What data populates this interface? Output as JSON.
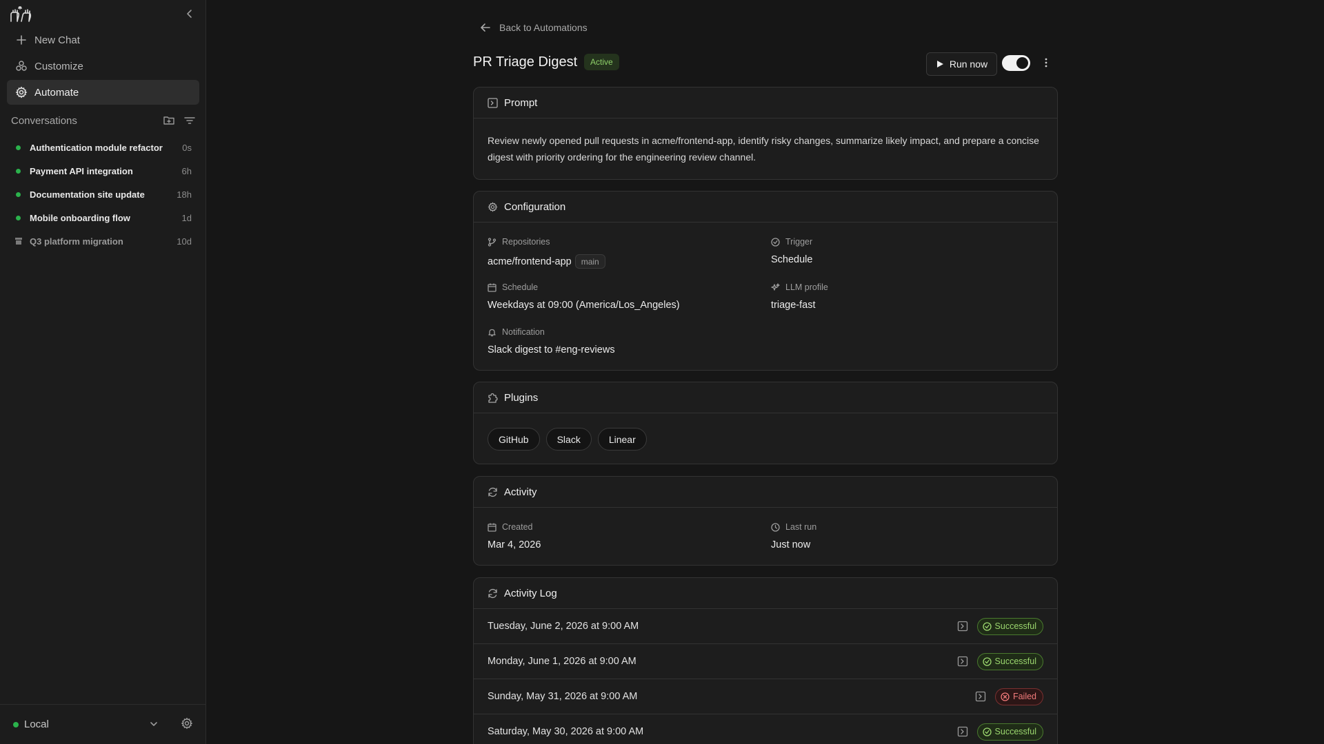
{
  "sidebar": {
    "nav": [
      {
        "label": "New Chat",
        "icon": "plus-icon"
      },
      {
        "label": "Customize",
        "icon": "customize-icon"
      },
      {
        "label": "Automate",
        "icon": "gear-icon"
      }
    ],
    "conversations_label": "Conversations",
    "conversations": [
      {
        "title": "Authentication module refactor",
        "age": "0s",
        "status": "active"
      },
      {
        "title": "Payment API integration",
        "age": "6h",
        "status": "active"
      },
      {
        "title": "Documentation site update",
        "age": "18h",
        "status": "active"
      },
      {
        "title": "Mobile onboarding flow",
        "age": "1d",
        "status": "active"
      },
      {
        "title": "Q3 platform migration",
        "age": "10d",
        "status": "archived"
      }
    ],
    "environment": "Local"
  },
  "header": {
    "back_label": "Back to Automations",
    "title": "PR Triage Digest",
    "status": "Active",
    "run_label": "Run now",
    "enabled": true
  },
  "prompt": {
    "heading": "Prompt",
    "text": "Review newly opened pull requests in acme/frontend-app, identify risky changes, summarize likely impact, and prepare a concise digest with priority ordering for the engineering review channel."
  },
  "configuration": {
    "heading": "Configuration",
    "repositories_label": "Repositories",
    "repository": "acme/frontend-app",
    "branch": "main",
    "trigger_label": "Trigger",
    "trigger": "Schedule",
    "schedule_label": "Schedule",
    "schedule": "Weekdays at 09:00 (America/Los_Angeles)",
    "llm_label": "LLM profile",
    "llm": "triage-fast",
    "notification_label": "Notification",
    "notification": "Slack digest to #eng-reviews"
  },
  "plugins": {
    "heading": "Plugins",
    "items": [
      "GitHub",
      "Slack",
      "Linear"
    ]
  },
  "activity": {
    "heading": "Activity",
    "created_label": "Created",
    "created": "Mar 4, 2026",
    "last_run_label": "Last run",
    "last_run": "Just now"
  },
  "activity_log": {
    "heading": "Activity Log",
    "rows": [
      {
        "when": "Tuesday, June 2, 2026 at 9:00 AM",
        "result": "Successful"
      },
      {
        "when": "Monday, June 1, 2026 at 9:00 AM",
        "result": "Successful"
      },
      {
        "when": "Sunday, May 31, 2026 at 9:00 AM",
        "result": "Failed"
      },
      {
        "when": "Saturday, May 30, 2026 at 9:00 AM",
        "result": "Successful"
      }
    ]
  },
  "colors": {
    "background": "#161616",
    "sidebar": "#1c1c1c",
    "success": "#9bd66e",
    "failure": "#f07a7a",
    "status_dot": "#2bb24c"
  }
}
